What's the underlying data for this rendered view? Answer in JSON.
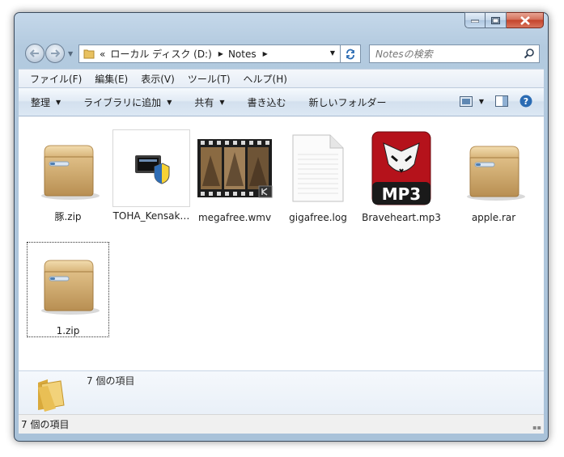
{
  "window": {
    "minimize_icon": "minimize-icon",
    "maximize_icon": "maximize-icon",
    "close_icon": "close-icon"
  },
  "nav": {
    "back_icon": "back-arrow-icon",
    "forward_icon": "forward-arrow-icon",
    "breadcrumb": [
      "«",
      "ローカル ディスク (D:)",
      "Notes"
    ],
    "search_placeholder": "Notesの検索"
  },
  "menu": [
    "ファイル(F)",
    "編集(E)",
    "表示(V)",
    "ツール(T)",
    "ヘルプ(H)"
  ],
  "toolbar": {
    "organize": "整理",
    "add_library": "ライブラリに追加",
    "share": "共有",
    "burn": "書き込む",
    "new_folder": "新しいフォルダー"
  },
  "files": [
    {
      "name": "豚.zip",
      "icon": "archive-box-icon"
    },
    {
      "name": "TOHA_Kensak…",
      "icon": "installer-shield-icon"
    },
    {
      "name": "megafree.wmv",
      "icon": "video-filmstrip-icon"
    },
    {
      "name": "gigafree.log",
      "icon": "text-document-icon"
    },
    {
      "name": "Braveheart.mp3",
      "icon": "mp3-fox-icon"
    },
    {
      "name": "apple.rar",
      "icon": "archive-box-icon"
    },
    {
      "name": "1.zip",
      "icon": "archive-box-icon"
    }
  ],
  "details": {
    "count": "7 個の項目"
  },
  "status": {
    "text": "7 個の項目"
  },
  "colors": {
    "mp3_red": "#c4161c",
    "box_tan": "#d9b77e",
    "accent_blue": "#2a6bb3"
  }
}
